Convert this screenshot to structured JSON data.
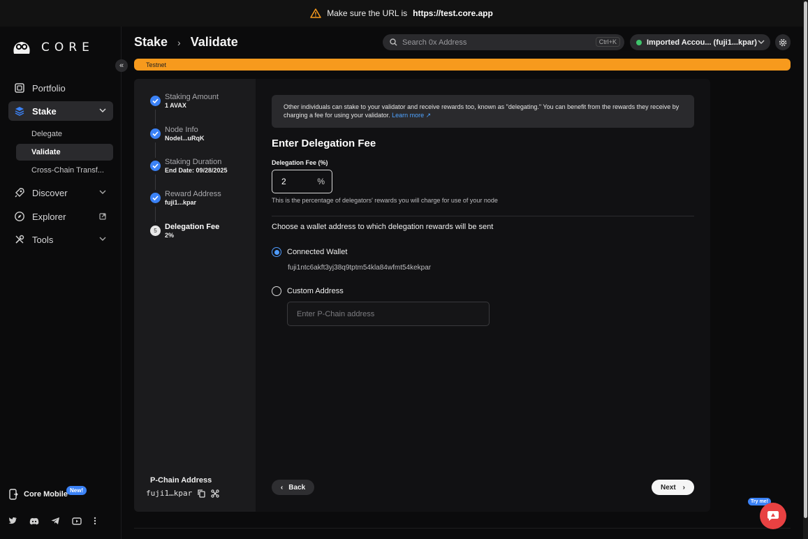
{
  "banner": {
    "text": "Make sure the URL is",
    "url": "https://test.core.app"
  },
  "brand": {
    "name": "CORE"
  },
  "sidebar": {
    "items": [
      {
        "label": "Portfolio",
        "icon": "portfolio-icon"
      },
      {
        "label": "Stake",
        "icon": "stake-icon",
        "expanded": true
      },
      {
        "label": "Discover",
        "icon": "rocket-icon"
      },
      {
        "label": "Explorer",
        "icon": "compass-icon"
      },
      {
        "label": "Tools",
        "icon": "tools-icon"
      }
    ],
    "stake_sub": [
      "Delegate",
      "Validate",
      "Cross-Chain Transf..."
    ],
    "core_mobile": "Core Mobile",
    "new_badge": "New!"
  },
  "header": {
    "crumb1": "Stake",
    "crumb2": "Validate",
    "search_placeholder": "Search 0x Address",
    "search_shortcut": "Ctrl+K",
    "account": "Imported Accou... (fuji1...kpar)",
    "network_badge": "Testnet"
  },
  "steps": [
    {
      "title": "Staking Amount",
      "value": "1 AVAX",
      "done": true
    },
    {
      "title": "Node Info",
      "value": "NodeI...uRqK",
      "done": true
    },
    {
      "title": "Staking Duration",
      "value": "End Date: 09/28/2025",
      "done": true
    },
    {
      "title": "Reward Address",
      "value": "fuji1...kpar",
      "done": true
    },
    {
      "title": "Delegation Fee",
      "value": "2%",
      "done": false,
      "number": "5"
    }
  ],
  "pchain": {
    "label": "P-Chain Address",
    "value": "fuji1…kpar"
  },
  "form": {
    "info_text": "Other individuals can stake to your validator and receive rewards too, known as \"delegating.\" You can benefit from the rewards they receive by charging a fee for using your validator.",
    "info_link": "Learn more",
    "heading": "Enter Delegation Fee",
    "fee_label": "Delegation Fee (%)",
    "fee_value": "2",
    "fee_unit": "%",
    "fee_helper": "This is the percentage of delegators' rewards you will charge for use of your node",
    "wallet_question": "Choose a wallet address to which delegation rewards will be sent",
    "option_connected": "Connected Wallet",
    "connected_address": "fuji1ntc6akft3yj38q9tptm54kla84wfmt54kekpar",
    "option_custom": "Custom Address",
    "custom_placeholder": "Enter P-Chain address",
    "selected": "connected"
  },
  "actions": {
    "back": "Back",
    "next": "Next"
  },
  "chat": {
    "badge": "Try me!"
  },
  "colors": {
    "accent": "#3b82f6",
    "testnet": "#f79a1d",
    "brand_red": "#e84142"
  }
}
